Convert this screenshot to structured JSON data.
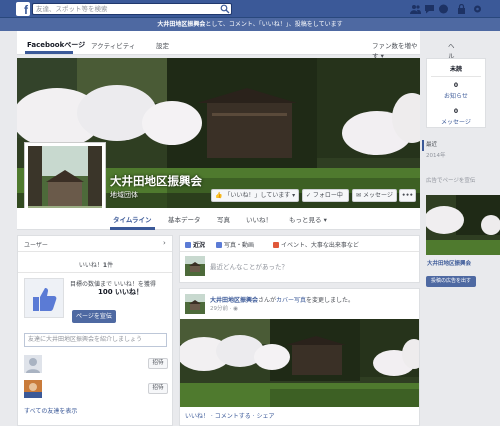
{
  "topbar": {
    "search_placeholder": "友達、スポット等を検索"
  },
  "admin_bar": {
    "text_prefix": "大井田地区振興会",
    "text_suffix": "として、コメント、「いいね！」、投稿をしています"
  },
  "page_nav": {
    "items": [
      "Facebookページ",
      "アクティビティ",
      "設定"
    ],
    "promote": "ファン数を増やす ▾",
    "help": "ヘルプ ▾"
  },
  "cover": {
    "page_name": "大井田地区振興会",
    "category": "地域団体",
    "like_button": "「いいね！」しています ▾",
    "follow_button": "✓ フォロー中",
    "message_button": "メッセージ",
    "more_button": "•••"
  },
  "timeline_nav": {
    "items": [
      "タイムライン",
      "基本データ",
      "写真",
      "いいね！",
      "もっと見る ▾"
    ]
  },
  "right_sidebar": {
    "unread_label": "未読",
    "notif_count": "0",
    "notif_label": "お知らせ",
    "msg_count": "0",
    "msg_label": "メッセージ",
    "years": [
      "最近",
      "2014年"
    ],
    "ad_title": "広告でページを宣伝",
    "ad_page_name": "大井田地区振興会",
    "ad_button": "投稿の広告を出す"
  },
  "left_card": {
    "title": "ユーザー",
    "likes_prefix": "いいね！",
    "likes_count": "1",
    "likes_suffix": "件",
    "goal_text": "目標の数値まで いいね！を獲得",
    "goal_num": "100 いいね！",
    "promote_button": "ページを宣伝",
    "invite_placeholder": "友達に大井田地区振興会を紹介しましょう",
    "invite_button": "招待",
    "see_all": "すべての友達を表示"
  },
  "composer": {
    "tabs": [
      "近況",
      "写真・動画",
      "イベント、大事な出来事など"
    ],
    "placeholder": "最近どんなことがあった？"
  },
  "post": {
    "author": "大井田地区振興会",
    "middle": "さんが",
    "link": "カバー写真",
    "suffix": "を変更しました。",
    "time": "29分前 · ",
    "actions": "いいね！ · コメントする · シェア"
  },
  "colors": {
    "brand": "#3b5998",
    "admin_bar": "#4e69a2",
    "background": "#e9eaed"
  }
}
